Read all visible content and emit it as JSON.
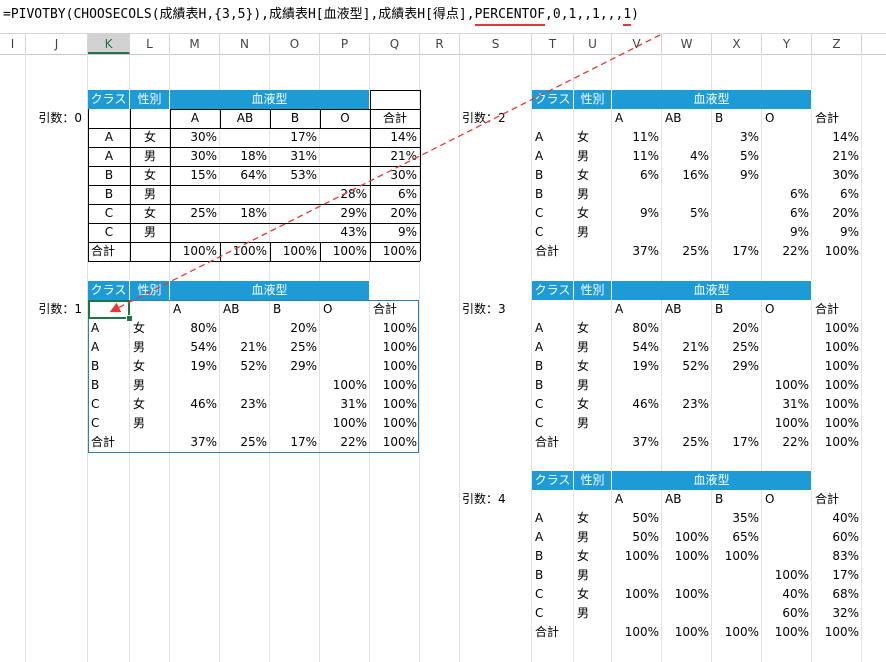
{
  "formula": {
    "prefix": "=PIVOTBY(CHOOSECOLS(成績表H,{3,5}),成績表H[血液型],成績表H[得点],",
    "highlight_fn": "PERCENTOF",
    "middle": ",0,1,,1,,,",
    "highlight_arg": "1",
    "suffix": ")"
  },
  "columns": [
    "I",
    "J",
    "K",
    "L",
    "M",
    "N",
    "O",
    "P",
    "Q",
    "R",
    "S",
    "T",
    "U",
    "V",
    "W",
    "X",
    "Y",
    "Z"
  ],
  "selected_column": "K",
  "accent_color": "#1d9bd7",
  "headers": {
    "class": "クラス",
    "gender": "性別",
    "blood": "血液型",
    "total": "合計",
    "blood_types": [
      "A",
      "AB",
      "B",
      "O"
    ]
  },
  "row_keys": [
    [
      "A",
      "女"
    ],
    [
      "A",
      "男"
    ],
    [
      "B",
      "女"
    ],
    [
      "B",
      "男"
    ],
    [
      "C",
      "女"
    ],
    [
      "C",
      "男"
    ]
  ],
  "tables": [
    {
      "label": "引数：0",
      "rows": [
        [
          "30%",
          "",
          "17%",
          "",
          "14%"
        ],
        [
          "30%",
          "18%",
          "31%",
          "",
          "21%"
        ],
        [
          "15%",
          "64%",
          "53%",
          "",
          "30%"
        ],
        [
          "",
          "",
          "",
          "28%",
          "6%"
        ],
        [
          "25%",
          "18%",
          "",
          "29%",
          "20%"
        ],
        [
          "",
          "",
          "",
          "43%",
          "9%"
        ]
      ],
      "total": [
        "100%",
        "100%",
        "100%",
        "100%",
        "100%"
      ]
    },
    {
      "label": "引数：1",
      "rows": [
        [
          "80%",
          "",
          "20%",
          "",
          "100%"
        ],
        [
          "54%",
          "21%",
          "25%",
          "",
          "100%"
        ],
        [
          "19%",
          "52%",
          "29%",
          "",
          "100%"
        ],
        [
          "",
          "",
          "",
          "100%",
          "100%"
        ],
        [
          "46%",
          "23%",
          "",
          "31%",
          "100%"
        ],
        [
          "",
          "",
          "",
          "100%",
          "100%"
        ]
      ],
      "total": [
        "37%",
        "25%",
        "17%",
        "22%",
        "100%"
      ]
    },
    {
      "label": "引数：2",
      "rows": [
        [
          "11%",
          "",
          "3%",
          "",
          "14%"
        ],
        [
          "11%",
          "4%",
          "5%",
          "",
          "21%"
        ],
        [
          "6%",
          "16%",
          "9%",
          "",
          "30%"
        ],
        [
          "",
          "",
          "",
          "6%",
          "6%"
        ],
        [
          "9%",
          "5%",
          "",
          "6%",
          "20%"
        ],
        [
          "",
          "",
          "",
          "9%",
          "9%"
        ]
      ],
      "total": [
        "37%",
        "25%",
        "17%",
        "22%",
        "100%"
      ]
    },
    {
      "label": "引数：3",
      "rows": [
        [
          "80%",
          "",
          "20%",
          "",
          "100%"
        ],
        [
          "54%",
          "21%",
          "25%",
          "",
          "100%"
        ],
        [
          "19%",
          "52%",
          "29%",
          "",
          "100%"
        ],
        [
          "",
          "",
          "",
          "100%",
          "100%"
        ],
        [
          "46%",
          "23%",
          "",
          "31%",
          "100%"
        ],
        [
          "",
          "",
          "",
          "100%",
          "100%"
        ]
      ],
      "total": [
        "37%",
        "25%",
        "17%",
        "22%",
        "100%"
      ]
    },
    {
      "label": "引数：4",
      "rows": [
        [
          "50%",
          "",
          "35%",
          "",
          "40%"
        ],
        [
          "50%",
          "100%",
          "65%",
          "",
          "60%"
        ],
        [
          "100%",
          "100%",
          "100%",
          "",
          "83%"
        ],
        [
          "",
          "",
          "",
          "100%",
          "17%"
        ],
        [
          "100%",
          "100%",
          "",
          "40%",
          "68%"
        ],
        [
          "",
          "",
          "",
          "60%",
          "32%"
        ]
      ],
      "total": [
        "100%",
        "100%",
        "100%",
        "100%",
        "100%"
      ]
    }
  ]
}
